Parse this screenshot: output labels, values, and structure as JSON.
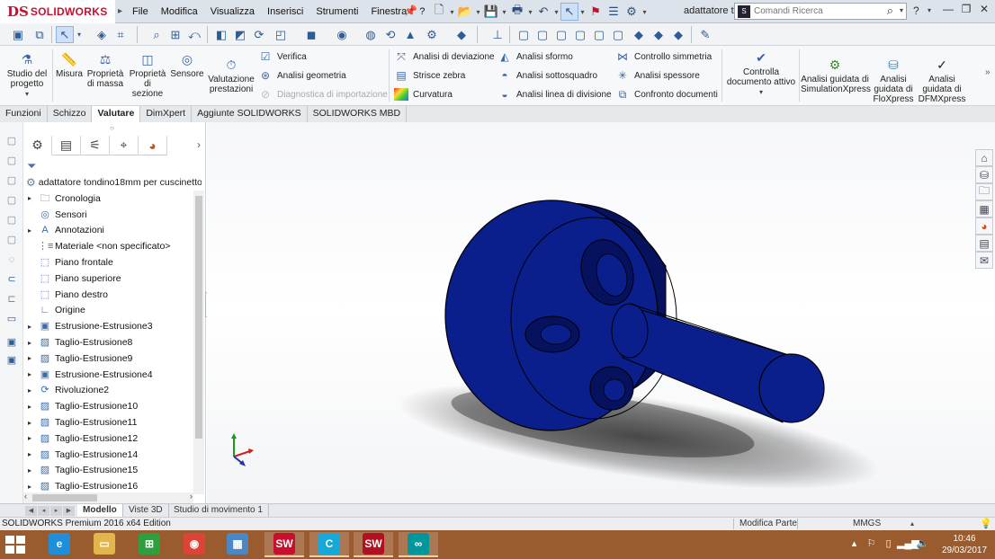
{
  "app": {
    "logo_mark": "DS",
    "logo_text": "SOLIDWORKS",
    "document_title": "adattatore to..."
  },
  "menu": [
    "File",
    "Modifica",
    "Visualizza",
    "Inserisci",
    "Strumenti",
    "Finestra",
    "?"
  ],
  "search": {
    "placeholder": "Comandi Ricerca"
  },
  "help_label": "?",
  "command_manager": {
    "studio": "Studio del progetto",
    "misura": "Misura",
    "proprieta_massa": "Proprietà di massa",
    "proprieta_sezione": "Proprietà di sezione",
    "sensore": "Sensore",
    "valutazione": "Valutazione prestazioni",
    "verifica": "Verifica",
    "analisi_geometria": "Analisi geometria",
    "diagnostica": "Diagnostica di importazione",
    "analisi_deviazione": "Analisi di deviazione",
    "strisce_zebra": "Strisce zebra",
    "curvatura": "Curvatura",
    "analisi_sformo": "Analisi sformo",
    "analisi_sottosquadro": "Analisi sottosquadro",
    "analisi_linea": "Analisi linea di divisione",
    "controllo_simmetria": "Controllo simmetria",
    "analisi_spessore": "Analisi spessore",
    "confronto_documenti": "Confronto documenti",
    "controlla_documento": "Controlla documento attivo",
    "simulationxpress": "Analisi guidata di SimulationXpress",
    "floxpress": "Analisi guidata di FloXpress",
    "dfmxpress": "Analisi guidata di DFMXpress"
  },
  "tabs": [
    "Funzioni",
    "Schizzo",
    "Valutare",
    "DimXpert",
    "Aggiunte SOLIDWORKS",
    "SOLIDWORKS MBD"
  ],
  "active_tab": "Valutare",
  "feature_tree": {
    "root": "adattatore tondino18mm per cuscinetto",
    "items": [
      {
        "label": "Cronologia",
        "expandable": true,
        "icon": "folder-icon"
      },
      {
        "label": "Sensori",
        "expandable": false,
        "icon": "sensor-icon"
      },
      {
        "label": "Annotazioni",
        "expandable": true,
        "icon": "annotation-icon"
      },
      {
        "label": "Materiale <non specificato>",
        "expandable": false,
        "icon": "material-icon"
      },
      {
        "label": "Piano frontale",
        "expandable": false,
        "icon": "plane-icon"
      },
      {
        "label": "Piano superiore",
        "expandable": false,
        "icon": "plane-icon"
      },
      {
        "label": "Piano destro",
        "expandable": false,
        "icon": "plane-icon"
      },
      {
        "label": "Origine",
        "expandable": false,
        "icon": "origin-icon"
      },
      {
        "label": "Estrusione-Estrusione3",
        "expandable": true,
        "icon": "extrude-icon"
      },
      {
        "label": "Taglio-Estrusione8",
        "expandable": true,
        "icon": "cut-icon"
      },
      {
        "label": "Taglio-Estrusione9",
        "expandable": true,
        "icon": "cut-icon"
      },
      {
        "label": "Estrusione-Estrusione4",
        "expandable": true,
        "icon": "extrude-icon"
      },
      {
        "label": "Rivoluzione2",
        "expandable": true,
        "icon": "revolve-icon"
      },
      {
        "label": "Taglio-Estrusione10",
        "expandable": true,
        "icon": "cut-icon"
      },
      {
        "label": "Taglio-Estrusione11",
        "expandable": true,
        "icon": "cut-icon"
      },
      {
        "label": "Taglio-Estrusione12",
        "expandable": true,
        "icon": "cut-icon"
      },
      {
        "label": "Taglio-Estrusione14",
        "expandable": true,
        "icon": "cut-icon"
      },
      {
        "label": "Taglio-Estrusione15",
        "expandable": true,
        "icon": "cut-icon"
      },
      {
        "label": "Taglio-Estrusione16",
        "expandable": true,
        "icon": "cut-icon"
      }
    ]
  },
  "bottom_tabs": [
    "Modello",
    "Viste 3D",
    "Studio di movimento 1"
  ],
  "active_bottom_tab": "Modello",
  "status": {
    "edition": "SOLIDWORKS Premium 2016 x64 Edition",
    "mode": "Modifica Parte",
    "units": "MMGS"
  },
  "taskbar": {
    "apps": [
      {
        "name": "internet-explorer",
        "glyph": "e",
        "color": "#1e8fd8"
      },
      {
        "name": "file-explorer",
        "glyph": "▭",
        "color": "#e2b64d"
      },
      {
        "name": "store",
        "glyph": "⊞",
        "color": "#2e9e3f"
      },
      {
        "name": "chrome",
        "glyph": "◉",
        "color": "#db4437"
      },
      {
        "name": "photos",
        "glyph": "▦",
        "color": "#4a87c4"
      },
      {
        "name": "solidworks-app",
        "glyph": "SW",
        "color": "#c8102e"
      },
      {
        "name": "c-app",
        "glyph": "C",
        "color": "#16a8d8"
      },
      {
        "name": "solidworks-2016",
        "glyph": "SW",
        "color": "#b01020"
      },
      {
        "name": "arduino",
        "glyph": "∞",
        "color": "#00979c"
      }
    ],
    "time": "10:46",
    "date": "29/03/2017"
  },
  "colors": {
    "model": "#0a1e8c",
    "model_dark": "#06125e",
    "accent": "#c8102e",
    "taskbar": "#9a5b2e"
  }
}
